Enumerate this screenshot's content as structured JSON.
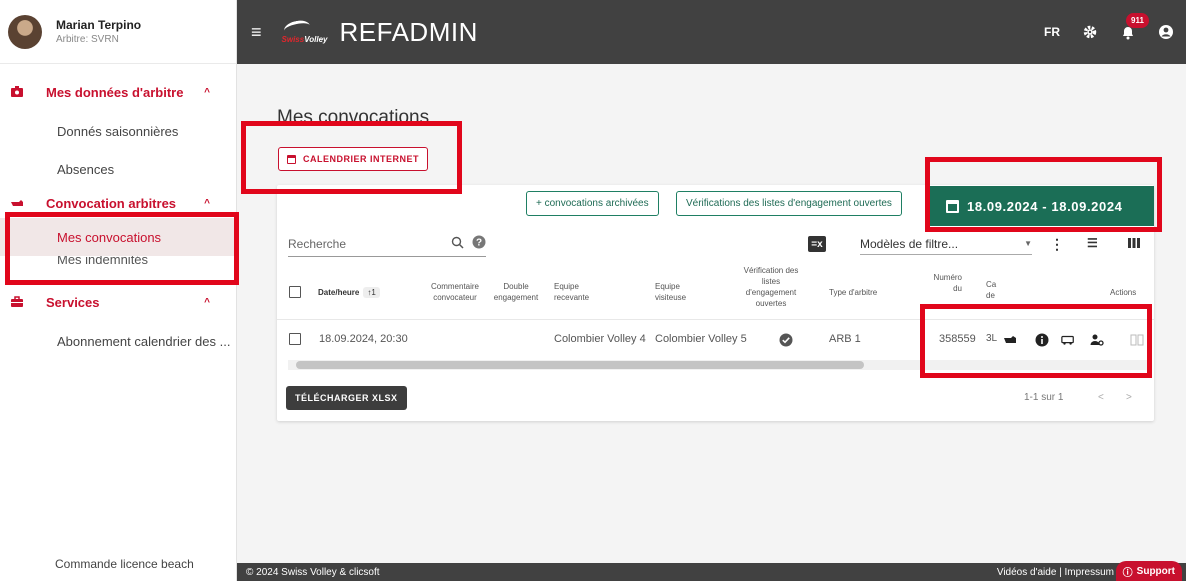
{
  "user": {
    "name": "Marian Terpino",
    "role": "Arbitre: SVRN"
  },
  "sidebar": {
    "groups": [
      {
        "label": "Mes données d'arbitre",
        "items": [
          "Donnés saisonnières",
          "Absences"
        ]
      },
      {
        "label": "Convocation arbitres",
        "items": [
          "Mes convocations",
          "Mes indemnités"
        ]
      },
      {
        "label": "Services",
        "items": [
          "Abonnement calendrier des ..."
        ]
      }
    ],
    "footer": "Commande licence beach",
    "chevron": "^"
  },
  "header": {
    "menu_icon": "≡",
    "logo_text_a": "Swiss",
    "logo_text_b": "Volley",
    "title": "REFADMIN",
    "lang": "FR",
    "notif_count": "911"
  },
  "main": {
    "page_title": "Mes convocations",
    "calendar_button": "CALENDRIER INTERNET",
    "archived_button": "+ convocations archivées",
    "verif_button": "Vérifications des listes d'engagement ouvertes",
    "date_range": "18.09.2024 - 18.09.2024",
    "search_placeholder": "Recherche",
    "filter_placeholder": "Modèles de filtre...",
    "columns": [
      "Date/heure",
      "Commentaire convocateur",
      "Double engagement",
      "Equipe recevante",
      "Equipe visiteuse",
      "Vérification des listes d'engagement ouvertes",
      "Type d'arbitre",
      "Numéro du",
      "Ca de",
      "Actions"
    ],
    "sort_label": "↑1",
    "row": {
      "datetime": "18.09.2024, 20:30",
      "home": "Colombier Volley 4",
      "away": "Colombier Volley 5",
      "ref_type": "ARB 1",
      "number": "358559",
      "ca": "3L"
    },
    "download_button": "TÉLÉCHARGER XLSX",
    "pagination": "1-1 sur 1",
    "prev": "<",
    "next": ">"
  },
  "footer": {
    "copyright": "© 2024 Swiss Volley & clicsoft",
    "links": "Vidéos d'aide | Impressum",
    "support": "Support"
  },
  "colors": {
    "brand_red": "#c8102e",
    "header_bg": "#414141",
    "date_green": "#1b6e56",
    "annotation_red": "#e1061b"
  }
}
